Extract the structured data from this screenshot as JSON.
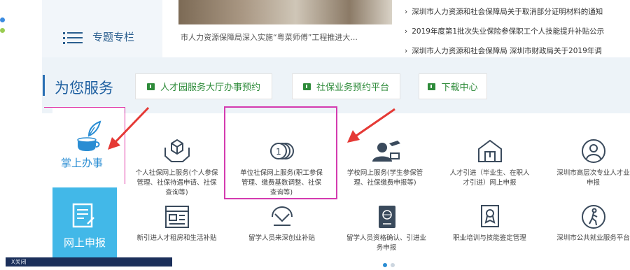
{
  "top": {
    "zhuanti_label": "专题专栏",
    "photo_caption": "市人力资源保障局深入实施“粤菜师傅”工程推进大...",
    "news": [
      "深圳市人力资源和社会保障局关于取消部分证明材料的通知",
      "2019年度第1批次失业保险参保职工个人技能提升补贴公示",
      "深圳市人力资源和社会保障局 深圳市财政局关于2019年调"
    ]
  },
  "services": {
    "title": "为您服务",
    "buttons": [
      {
        "label": "人才园服务大厅办事预约"
      },
      {
        "label": "社保业务预约平台"
      },
      {
        "label": "下载中心"
      }
    ]
  },
  "sidebar": {
    "zhangshang": "掌上办事",
    "wangshang": "网上申报"
  },
  "grid": {
    "row1": [
      {
        "icon": "hands-box-icon",
        "lines": [
          "个人社保网上服务(个人参保",
          "管理、社保待遇申请、社保",
          "查询等)"
        ]
      },
      {
        "icon": "coins-icon",
        "lines": [
          "单位社保网上服务(职工参保",
          "管理、缴费基数调整、社保",
          "查询等)"
        ]
      },
      {
        "icon": "graduate-icon",
        "lines": [
          "学校网上服务(学生参保管",
          "理、社保缴费申报等)"
        ]
      },
      {
        "icon": "talent-house-icon",
        "lines": [
          "人才引进（毕业生、在职人",
          "才引进）网上申报"
        ]
      },
      {
        "icon": "person-badge-icon",
        "lines": [
          "深圳市高层次专业人才业",
          "申报"
        ]
      }
    ],
    "row2": [
      {
        "icon": "browser-window-icon",
        "lines": [
          "新引进人才租房和生活补贴"
        ]
      },
      {
        "icon": "handshake-icon",
        "lines": [
          "留学人员来深创业补贴"
        ]
      },
      {
        "icon": "passport-icon",
        "lines": [
          "留学人员资格确认、引进业",
          "务申报"
        ]
      },
      {
        "icon": "certificate-icon",
        "lines": [
          "职业培训与技能鉴定管理"
        ]
      },
      {
        "icon": "walking-person-icon",
        "lines": [
          "深圳市公共就业服务平台"
        ]
      }
    ]
  },
  "closebar": {
    "label": "X关闭"
  },
  "colors": {
    "accent": "#1c5e9f",
    "green": "#2e8b3a",
    "highlight": "#d43bb0",
    "arrow": "#e53935",
    "side_blue": "#42b8e8"
  }
}
